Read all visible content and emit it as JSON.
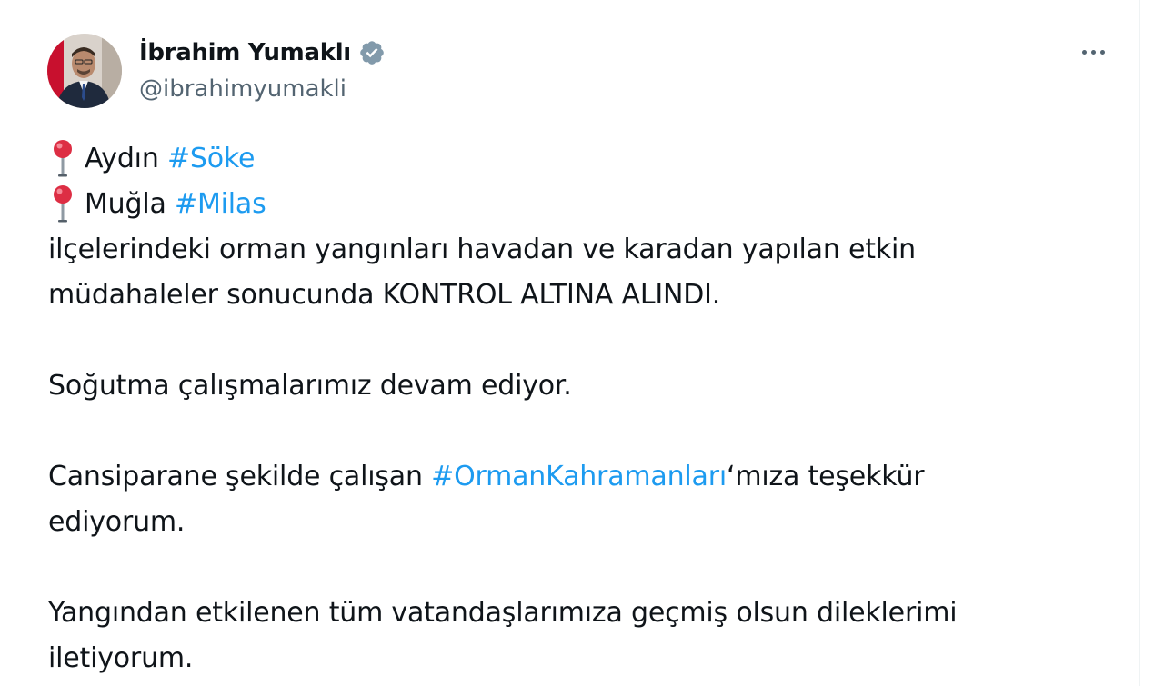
{
  "author": {
    "display_name": "İbrahim Yumaklı",
    "handle": "@ibrahimyumakli",
    "verified_icon": "verified-badge-icon"
  },
  "menu": {
    "icon": "more-options-icon"
  },
  "colors": {
    "hashtag": "#1d9bf0",
    "text": "#0f1419",
    "secondary": "#536471",
    "verified_badge": "#829aab",
    "pin": "#dd2e44"
  },
  "tweet": {
    "line1_place": "Aydın",
    "line1_tag": "#Söke",
    "line2_place": "Muğla",
    "line2_tag": "#Milas",
    "p1_line1": "ilçelerindeki orman yangınları havadan ve karadan yapılan etkin",
    "p1_line2": "müdahaleler sonucunda KONTROL ALTINA ALINDI.",
    "p2": "Soğutma çalışmalarımız devam ediyor.",
    "p3_prefix": "Cansiparane şekilde çalışan ",
    "p3_tag": "#OrmanKahramanları",
    "p3_suffix": "‘mıza teşekkür",
    "p3_line2": "ediyorum.",
    "p4_line1": "Yangından etkilenen tüm vatandaşlarımıza geçmiş olsun dileklerimi",
    "p4_line2": "iletiyorum."
  }
}
